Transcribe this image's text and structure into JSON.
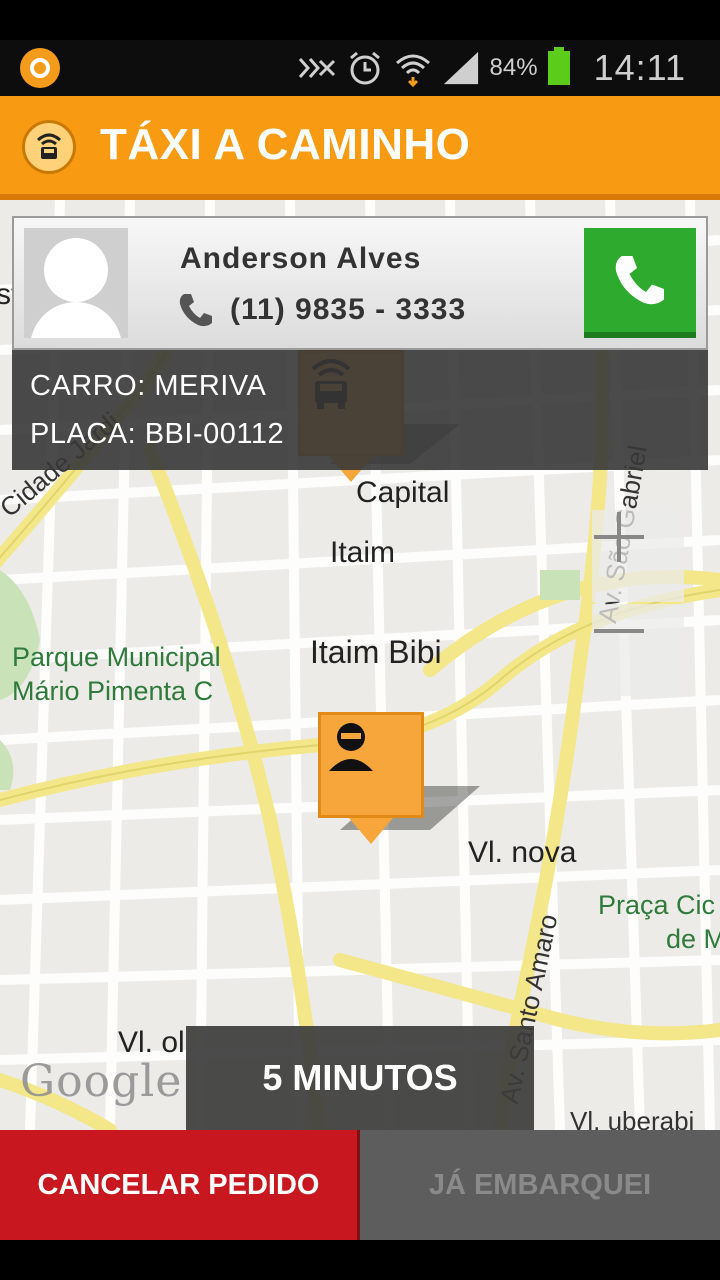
{
  "status_bar": {
    "battery_percent": "84%",
    "time": "14:11",
    "icons": [
      "app-notification-icon",
      "nfc-icon",
      "alarm-icon",
      "wifi-icon",
      "signal-icon",
      "battery-icon"
    ]
  },
  "header": {
    "title": "TÁXI A CAMINHO",
    "logo_icon": "taxi-signal-icon"
  },
  "driver": {
    "name": "Anderson Alves",
    "phone": "(11) 9835 - 3333",
    "call_icon": "phone-icon"
  },
  "car": {
    "model": "CARRO: MERIVA",
    "plate": "PLACA: BBI-00112"
  },
  "map": {
    "labels": {
      "capital": "Capital",
      "itaim": "Itaim",
      "itaim_bibi": "Itaim Bibi",
      "parque_1": "Parque Municipal",
      "parque_2": "Mário Pimenta C",
      "vl_nova": "Vl. nova",
      "praca_1": "Praça Cic",
      "praca_2": "de M",
      "vl_ol": "Vl. ol",
      "vl_uberabinha": "Vl. uberabi",
      "cidade_jardim": "Cidade Jardi",
      "sao_gabriel": "Av. São Gabriel",
      "santo_amaro": "Av. Santo Amaro",
      "edge_st": "st",
      "google": "Google"
    },
    "zoom_in": "+",
    "zoom_out": "−"
  },
  "eta": "5 MINUTOS",
  "actions": {
    "cancel": "CANCELAR PEDIDO",
    "boarded": "JÁ EMBARQUEI"
  },
  "colors": {
    "header_orange": "#f89a12",
    "call_green": "#2eaa2e",
    "cancel_red": "#c8171f",
    "marker_orange": "#f6a63a"
  }
}
